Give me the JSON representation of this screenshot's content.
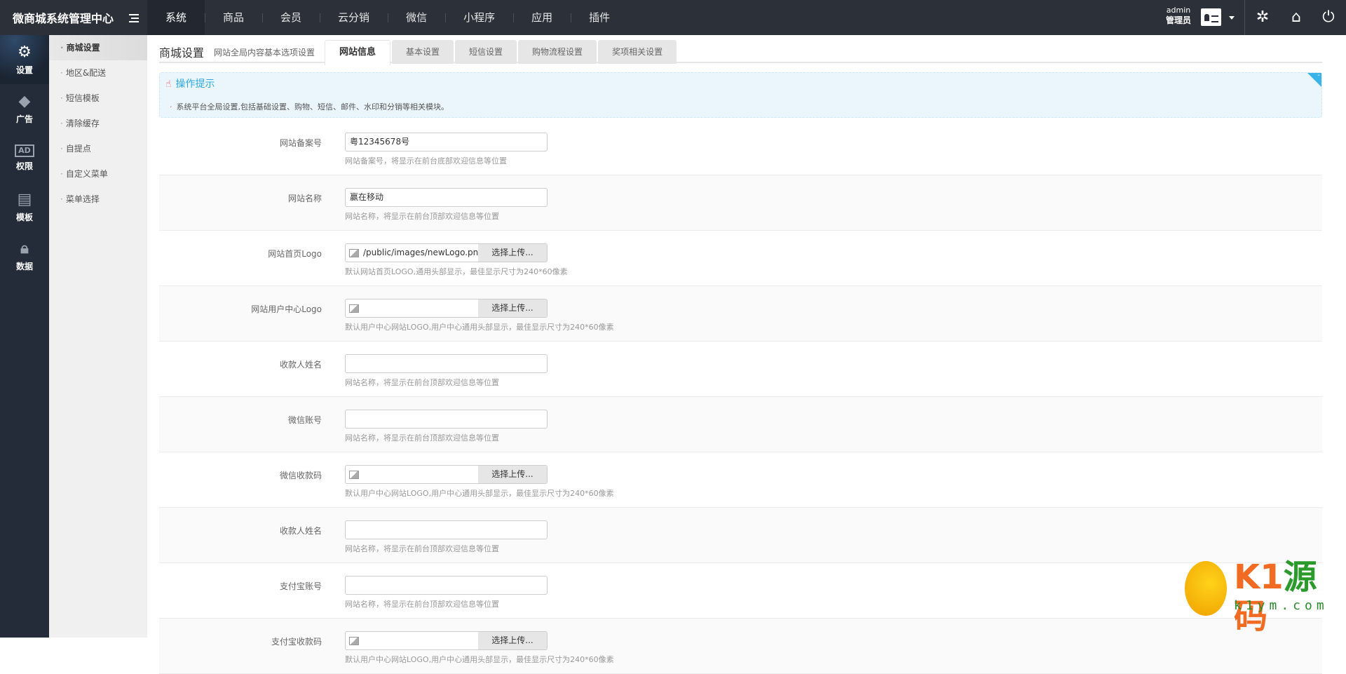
{
  "header": {
    "brand": "微商城系统管理中心",
    "nav": [
      "系统",
      "商品",
      "会员",
      "云分销",
      "微信",
      "小程序",
      "应用",
      "插件"
    ],
    "user_name": "admin",
    "user_role": "管理员"
  },
  "sidebar": [
    {
      "label": "设置",
      "icon": "gear-icon"
    },
    {
      "label": "广告",
      "icon": "diamond-icon"
    },
    {
      "label": "权限",
      "icon": "ad-board-icon"
    },
    {
      "label": "模板",
      "icon": "document-icon"
    },
    {
      "label": "数据",
      "icon": "lock-icon"
    }
  ],
  "submenu": [
    "商城设置",
    "地区&配送",
    "短信模板",
    "清除缓存",
    "自提点",
    "自定义菜单",
    "菜单选择"
  ],
  "page": {
    "title": "商城设置",
    "subtitle": "网站全局内容基本选项设置",
    "tabs": [
      "网站信息",
      "基本设置",
      "短信设置",
      "购物流程设置",
      "奖项相关设置"
    ]
  },
  "tip": {
    "title": "操作提示",
    "text": "系统平台全局设置,包括基础设置、购物、短信、邮件、水印和分销等相关模块。",
    "collapse": "-"
  },
  "upload_label": "选择上传...",
  "form": [
    {
      "label": "网站备案号",
      "type": "text",
      "value": "粤12345678号",
      "hint": "网站备案号，将显示在前台底部欢迎信息等位置"
    },
    {
      "label": "网站名称",
      "type": "text",
      "value": "赢在移动",
      "hint": "网站名称，将显示在前台顶部欢迎信息等位置"
    },
    {
      "label": "网站首页Logo",
      "type": "file",
      "value": "/public/images/newLogo.png",
      "hint": "默认网站首页LOGO,通用头部显示，最佳显示尺寸为240*60像素"
    },
    {
      "label": "网站用户中心Logo",
      "type": "file",
      "value": "",
      "hint": "默认用户中心网站LOGO,用户中心通用头部显示，最佳显示尺寸为240*60像素"
    },
    {
      "label": "收款人姓名",
      "type": "text",
      "value": "",
      "hint": "网站名称，将显示在前台顶部欢迎信息等位置"
    },
    {
      "label": "微信账号",
      "type": "text",
      "value": "",
      "hint": "网站名称，将显示在前台顶部欢迎信息等位置"
    },
    {
      "label": "微信收款码",
      "type": "file",
      "value": "",
      "hint": "默认用户中心网站LOGO,用户中心通用头部显示，最佳显示尺寸为240*60像素"
    },
    {
      "label": "收款人姓名",
      "type": "text",
      "value": "",
      "hint": "网站名称，将显示在前台顶部欢迎信息等位置"
    },
    {
      "label": "支付宝账号",
      "type": "text",
      "value": "",
      "hint": "网站名称，将显示在前台顶部欢迎信息等位置"
    },
    {
      "label": "支付宝收款码",
      "type": "file",
      "value": "",
      "hint": "默认用户中心网站LOGO,用户中心通用头部显示，最佳显示尺寸为240*60像素"
    }
  ],
  "watermark": {
    "brand_a": "K1",
    "brand_b": "源",
    "brand_c": "码",
    "url": "k1ym.com"
  }
}
